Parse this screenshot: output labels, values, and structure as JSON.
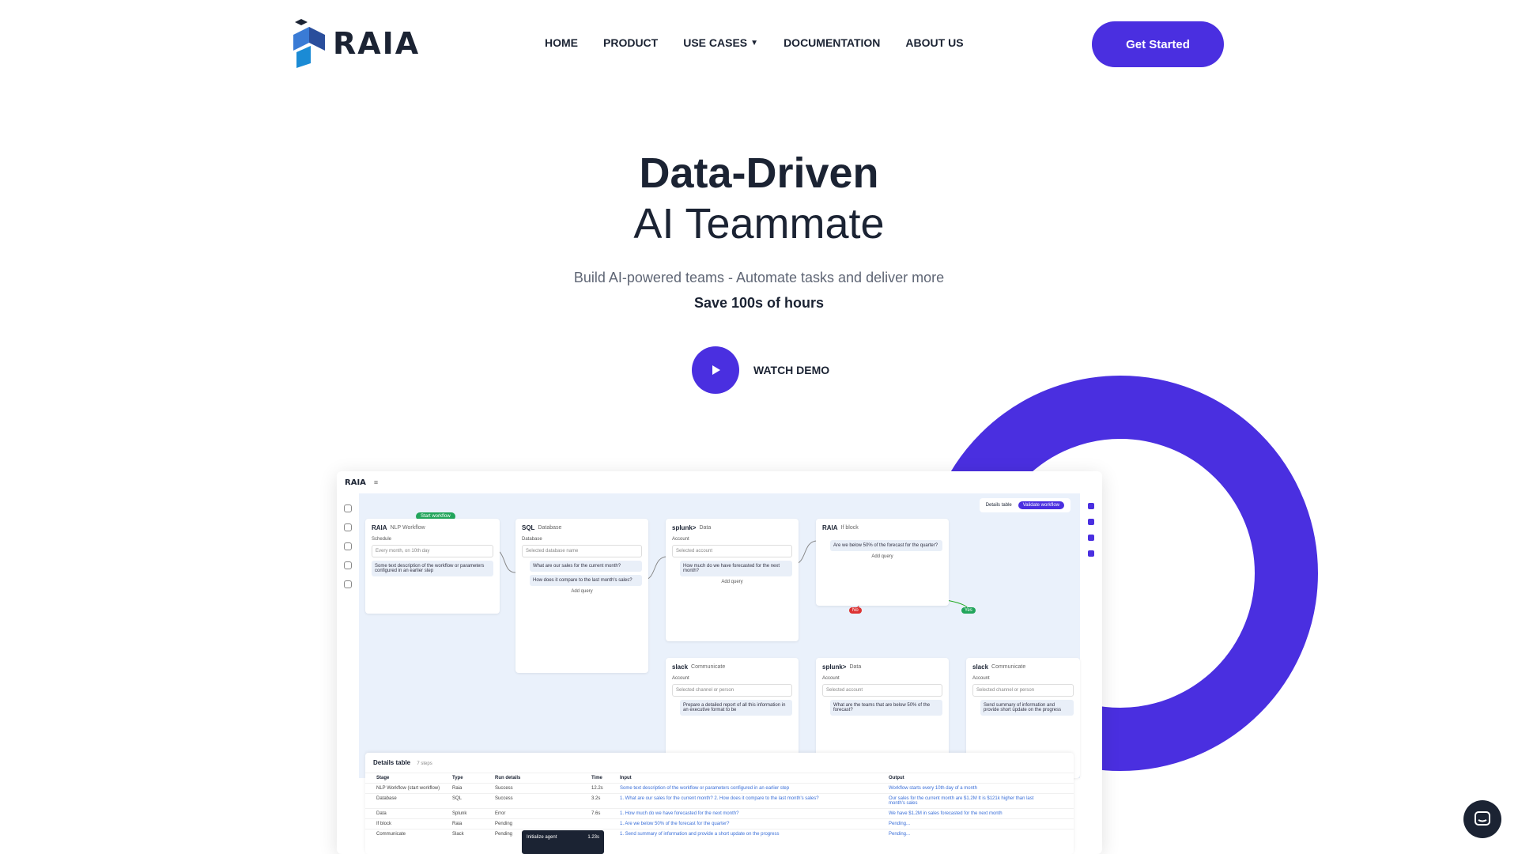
{
  "header": {
    "logo_text": "RAIA",
    "nav": [
      "HOME",
      "PRODUCT",
      "USE CASES",
      "DOCUMENTATION",
      "ABOUT US"
    ],
    "cta_label": "Get Started"
  },
  "hero": {
    "title_line1": "Data-Driven",
    "title_line2": "AI Teammate",
    "subtitle": "Build AI-powered teams - Automate tasks and deliver more",
    "highlight": "Save 100s of hours",
    "demo_label": "WATCH DEMO"
  },
  "mockup": {
    "logo": "RAIA",
    "details_toggle": "Details table",
    "validate": "Validate workflow",
    "start_badge": "Start workflow",
    "cards": [
      {
        "brand": "RAIA",
        "name": "NLP Workflow",
        "label": "Schedule",
        "field": "Every month, on 10th day",
        "note": "Some text description of the workflow or parameters configured in an earlier step"
      },
      {
        "brand": "SQL",
        "name": "Database",
        "label": "Database",
        "field": "Selected database name",
        "q1": "What are our sales for the current month?",
        "q2": "How does it compare to the last month's sales?",
        "add": "Add query"
      },
      {
        "brand": "splunk>",
        "name": "Data",
        "label": "Account",
        "field": "Selected account",
        "q1": "How much do we have forecasted for the next month?",
        "add": "Add query"
      },
      {
        "brand": "RAIA",
        "name": "If block",
        "q1": "Are we below 50% of the forecast for the quarter?",
        "add": "Add query"
      },
      {
        "brand": "slack",
        "name": "Communicate",
        "label": "Account",
        "field": "Selected channel or person",
        "q1": "Prepare a detailed report of all this information in an executive format to be"
      },
      {
        "brand": "splunk>",
        "name": "Data",
        "label": "Account",
        "field": "Selected account",
        "q1": "What are the teams that are below 50% of the forecast?"
      },
      {
        "brand": "slack",
        "name": "Communicate",
        "label": "Account",
        "field": "Selected channel or person",
        "q1": "Send summary of information and provide short update on the progress"
      }
    ],
    "yes": "Yes",
    "no": "No",
    "details": {
      "title": "Details table",
      "steps": "7 steps",
      "headers": [
        "Stage",
        "Type",
        "Run details",
        "Time",
        "Input",
        "Output"
      ],
      "rows": [
        [
          "NLP Workflow (start workflow)",
          "Raia",
          "Success",
          "12.2s",
          "Some text description of the workflow or parameters configured in an earlier step",
          "Workflow starts every 10th day of a month"
        ],
        [
          "Database",
          "SQL",
          "Success",
          "3.2s",
          "1. What are our sales for the current month?   2. How does it compare to the last month's sales?",
          "Our sales for the current month are $1.2M   It is $121k higher than last month's sales"
        ],
        [
          "Data",
          "Splunk",
          "Error",
          "7.6s",
          "1. How much do we have forecasted for the next month?",
          "We have $1.2M in sales forecasted for the next month"
        ],
        [
          "If block",
          "Raia",
          "Pending",
          "",
          "1. Are we below 50% of the forecast for the quarter?",
          "Pending..."
        ],
        [
          "Communicate",
          "Slack",
          "Pending",
          "",
          "1. Send summary of information and provide a short update on the progress",
          "Pending..."
        ]
      ]
    },
    "tooltip": {
      "label": "Initialize agent",
      "value": "1.23s"
    }
  },
  "colors": {
    "accent": "#4a2fe0",
    "text": "#1b2333",
    "muted": "#5f6675",
    "canvas": "#eaf1fb"
  },
  "icons": {
    "play": "play-icon",
    "chat": "chat-icon",
    "chevron": "chevron-down-icon"
  }
}
